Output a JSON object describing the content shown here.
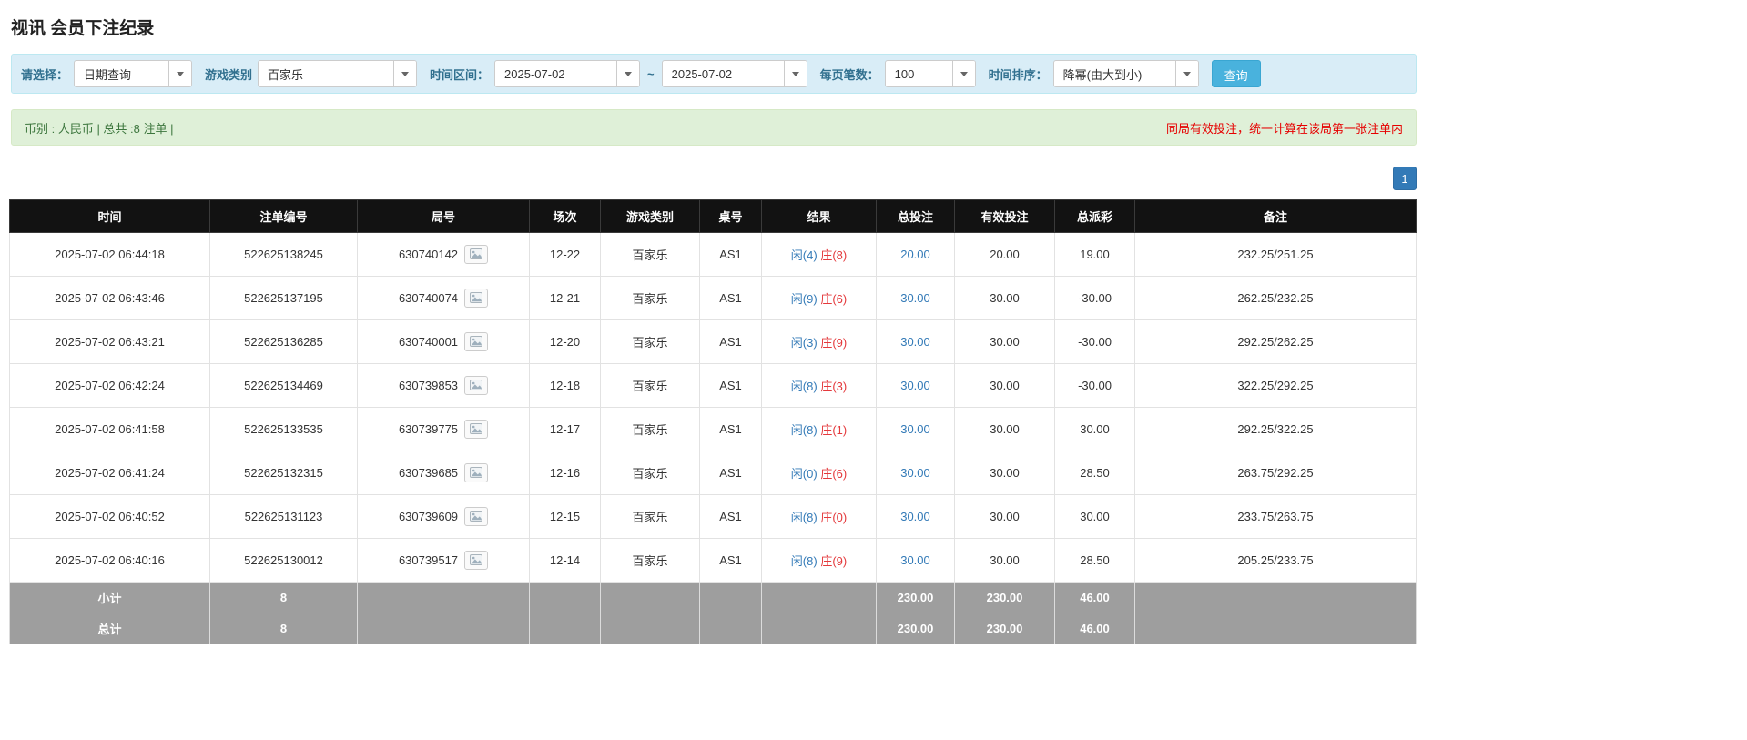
{
  "page_title": "视讯 会员下注纪录",
  "filters": {
    "select_label": "请选择：",
    "select_value": "日期查询",
    "game_type_label": "游戏类别",
    "game_type_value": "百家乐",
    "time_range_label": "时间区间：",
    "time_from": "2025-07-02",
    "time_separator": "~",
    "time_to": "2025-07-02",
    "page_size_label": "每页笔数：",
    "page_size_value": "100",
    "sort_label": "时间排序：",
    "sort_value": "降幂(由大到小)",
    "search_button_label": "查询"
  },
  "summary": {
    "left_text": "币别 : 人民币 | 总共 :8 注单 |",
    "right_note": "同局有效投注，统一计算在该局第一张注单内"
  },
  "pagination": {
    "current": "1"
  },
  "table": {
    "headers": [
      "时间",
      "注单编号",
      "局号",
      "场次",
      "游戏类别",
      "桌号",
      "结果",
      "总投注",
      "有效投注",
      "总派彩",
      "备注"
    ],
    "rows": [
      {
        "time": "2025-07-02 06:44:18",
        "bet_id": "522625138245",
        "round_id": "630740142",
        "session": "12-22",
        "game": "百家乐",
        "table_no": "AS1",
        "result_player": "闲(4)",
        "result_banker": "庄(8)",
        "total_bet": "20.00",
        "valid_bet": "20.00",
        "payout": "19.00",
        "remark": "232.25/251.25"
      },
      {
        "time": "2025-07-02 06:43:46",
        "bet_id": "522625137195",
        "round_id": "630740074",
        "session": "12-21",
        "game": "百家乐",
        "table_no": "AS1",
        "result_player": "闲(9)",
        "result_banker": "庄(6)",
        "total_bet": "30.00",
        "valid_bet": "30.00",
        "payout": "-30.00",
        "remark": "262.25/232.25"
      },
      {
        "time": "2025-07-02 06:43:21",
        "bet_id": "522625136285",
        "round_id": "630740001",
        "session": "12-20",
        "game": "百家乐",
        "table_no": "AS1",
        "result_player": "闲(3)",
        "result_banker": "庄(9)",
        "total_bet": "30.00",
        "valid_bet": "30.00",
        "payout": "-30.00",
        "remark": "292.25/262.25"
      },
      {
        "time": "2025-07-02 06:42:24",
        "bet_id": "522625134469",
        "round_id": "630739853",
        "session": "12-18",
        "game": "百家乐",
        "table_no": "AS1",
        "result_player": "闲(8)",
        "result_banker": "庄(3)",
        "total_bet": "30.00",
        "valid_bet": "30.00",
        "payout": "-30.00",
        "remark": "322.25/292.25"
      },
      {
        "time": "2025-07-02 06:41:58",
        "bet_id": "522625133535",
        "round_id": "630739775",
        "session": "12-17",
        "game": "百家乐",
        "table_no": "AS1",
        "result_player": "闲(8)",
        "result_banker": "庄(1)",
        "total_bet": "30.00",
        "valid_bet": "30.00",
        "payout": "30.00",
        "remark": "292.25/322.25"
      },
      {
        "time": "2025-07-02 06:41:24",
        "bet_id": "522625132315",
        "round_id": "630739685",
        "session": "12-16",
        "game": "百家乐",
        "table_no": "AS1",
        "result_player": "闲(0)",
        "result_banker": "庄(6)",
        "total_bet": "30.00",
        "valid_bet": "30.00",
        "payout": "28.50",
        "remark": "263.75/292.25"
      },
      {
        "time": "2025-07-02 06:40:52",
        "bet_id": "522625131123",
        "round_id": "630739609",
        "session": "12-15",
        "game": "百家乐",
        "table_no": "AS1",
        "result_player": "闲(8)",
        "result_banker": "庄(0)",
        "total_bet": "30.00",
        "valid_bet": "30.00",
        "payout": "30.00",
        "remark": "233.75/263.75"
      },
      {
        "time": "2025-07-02 06:40:16",
        "bet_id": "522625130012",
        "round_id": "630739517",
        "session": "12-14",
        "game": "百家乐",
        "table_no": "AS1",
        "result_player": "闲(8)",
        "result_banker": "庄(9)",
        "total_bet": "30.00",
        "valid_bet": "30.00",
        "payout": "28.50",
        "remark": "205.25/233.75"
      }
    ],
    "subtotal": {
      "label": "小计",
      "count": "8",
      "total_bet": "230.00",
      "valid_bet": "230.00",
      "payout": "46.00"
    },
    "total": {
      "label": "总计",
      "count": "8",
      "total_bet": "230.00",
      "valid_bet": "230.00",
      "payout": "46.00"
    }
  },
  "colors": {
    "link_blue": "#337ab7",
    "player_blue": "#337ab7",
    "banker_red": "#e4393c",
    "negative_red": "#e4393c",
    "note_red": "#e60000",
    "filter_bar_bg": "#d9edf7",
    "filter_label_text": "#31708f",
    "summary_bar_bg": "#dff0d8",
    "summary_text_green": "#3c763d",
    "search_button_bg": "#49b2dd",
    "pagination_bg": "#337ab7",
    "table_header_bg": "#121212",
    "footer_row_bg": "#9e9e9e"
  }
}
